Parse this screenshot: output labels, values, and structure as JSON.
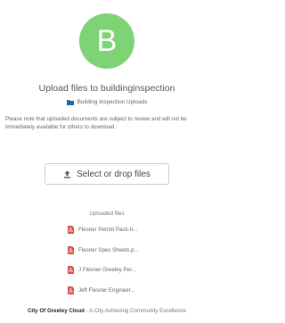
{
  "theme": {
    "accent": "#7ed374",
    "folder_color": "#1f6aa5",
    "pdf_color": "#d9534f"
  },
  "avatar": {
    "letter": "B"
  },
  "header": {
    "title": "Upload files to buildinginspection",
    "folder_icon": "folder-icon",
    "folder_name": "Building Inspection Uploads"
  },
  "notice": "Please note that uploaded documents are subject to review and will not be immediately available for others to download.",
  "upload": {
    "icon": "upload-icon",
    "label": "Select or drop files"
  },
  "uploaded": {
    "heading": "Uploaded files",
    "file_icon": "pdf-file-icon",
    "files": [
      {
        "name": "Flesner Permit Pack-II..."
      },
      {
        "name": "Flesner Spec Sheets.p..."
      },
      {
        "name": "J Flesner Greeley Per..."
      },
      {
        "name": "Jeff Flesner Engineer..."
      }
    ]
  },
  "footer": {
    "org": "City Of Greeley Cloud",
    "tagline": " - A City Achieving Community Excellence"
  }
}
